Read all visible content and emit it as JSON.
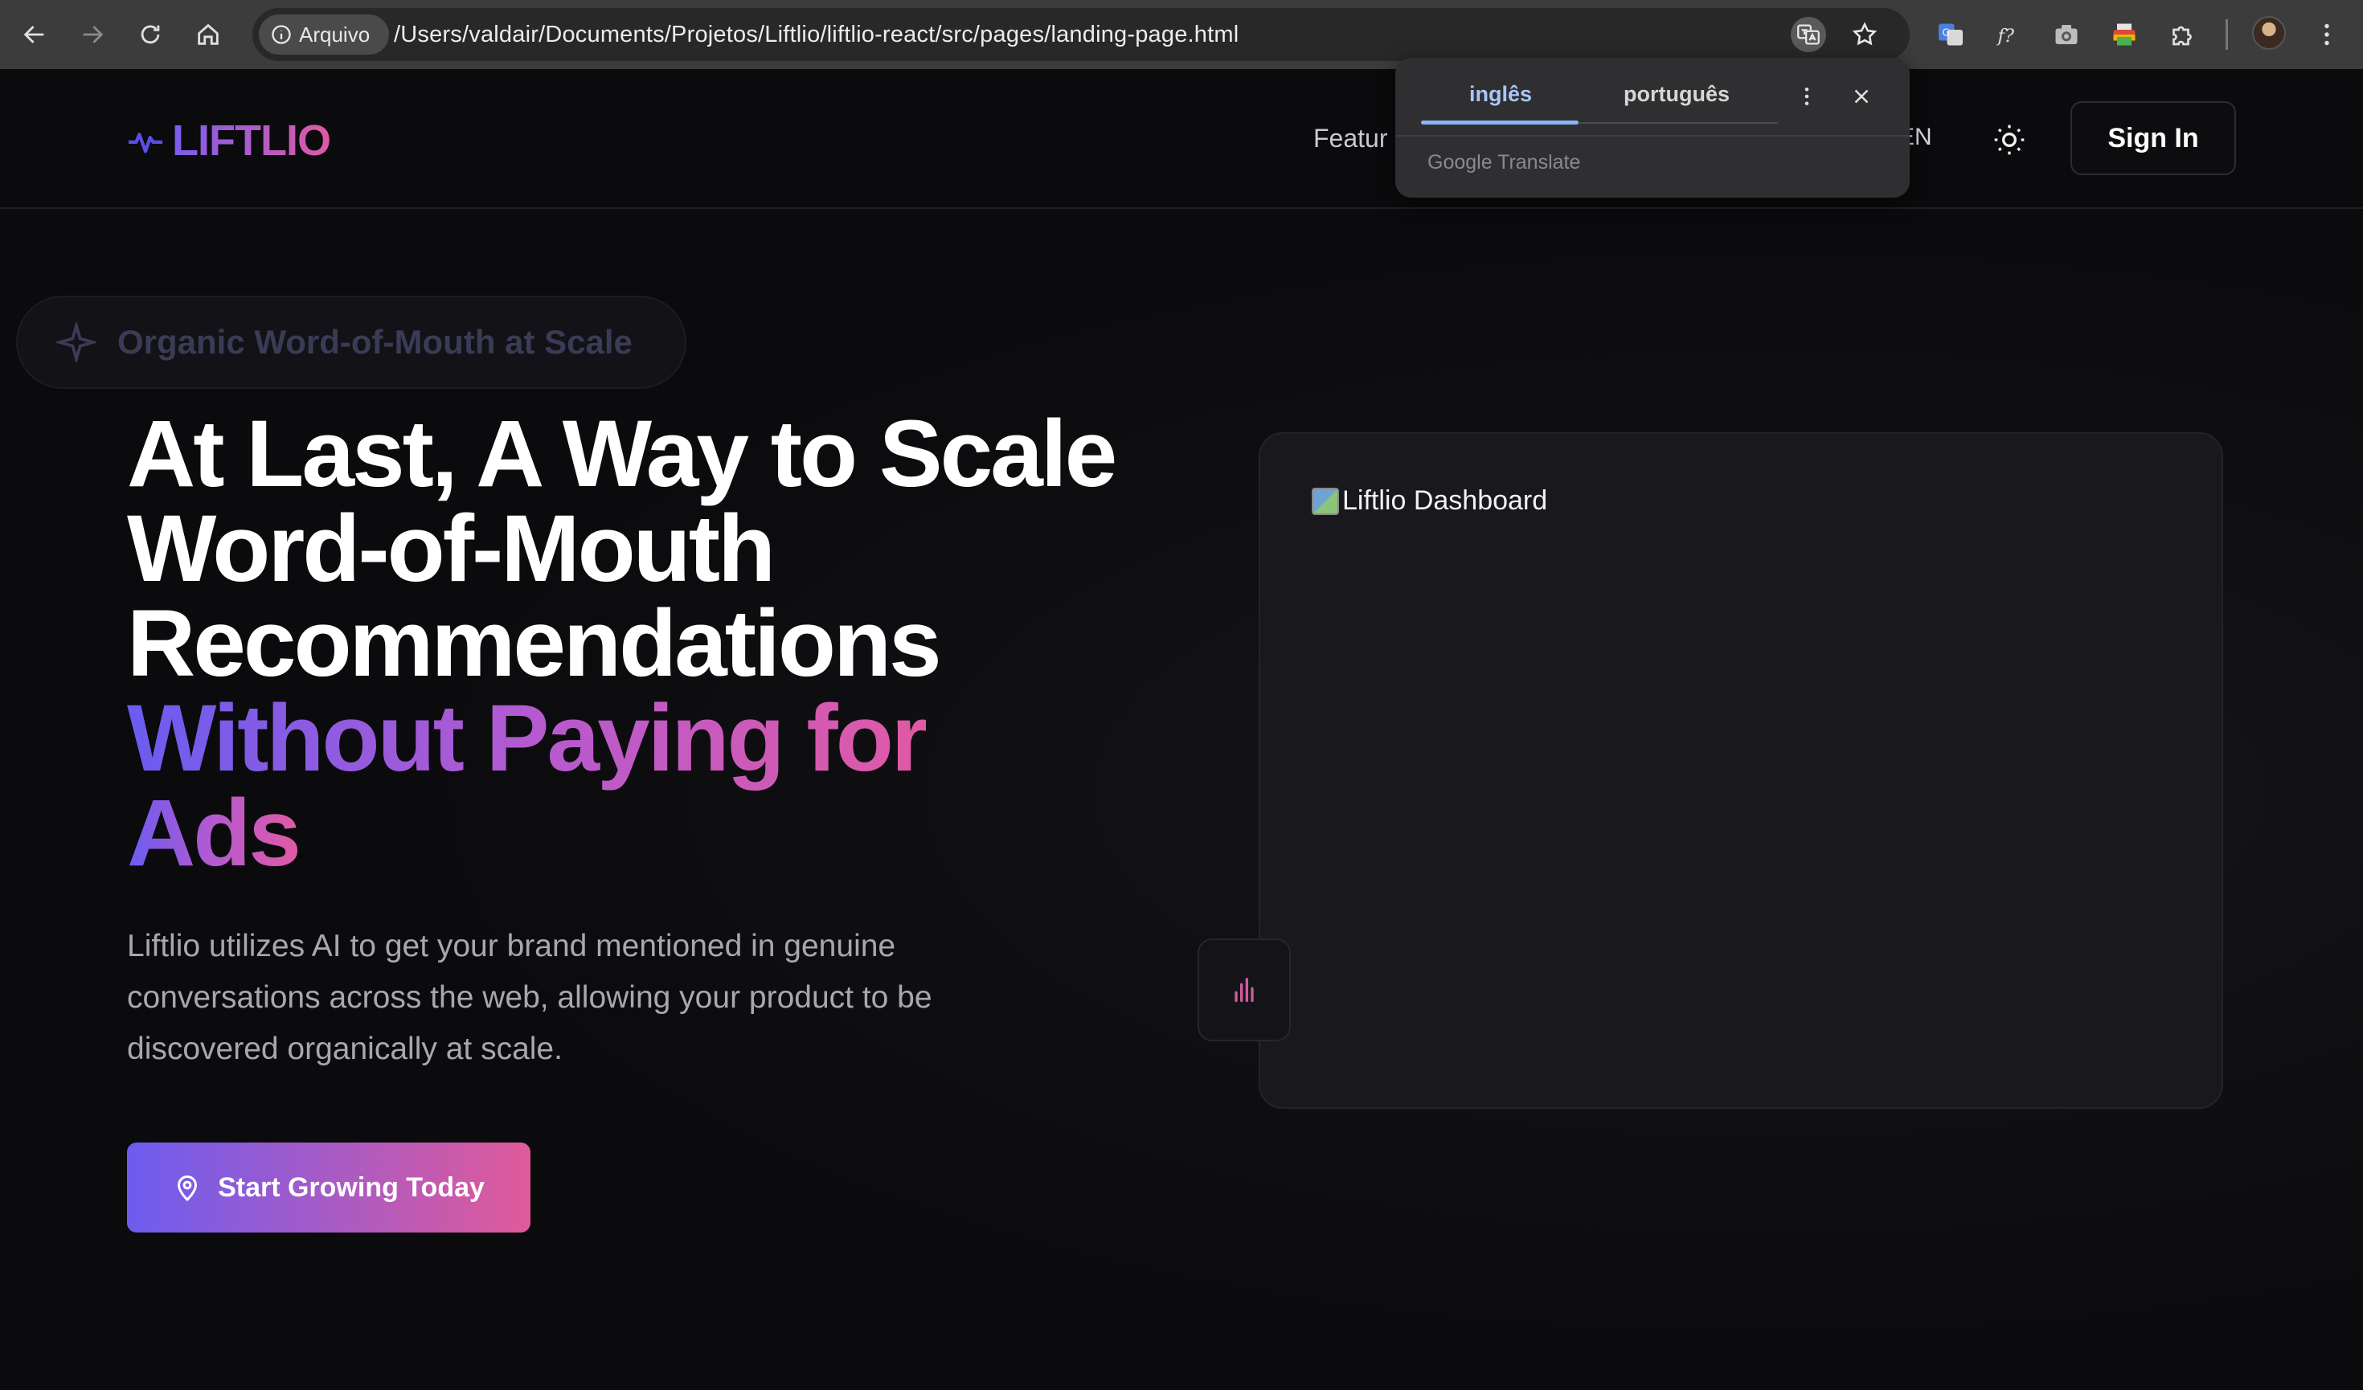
{
  "browser": {
    "site_chip_label": "Arquivo",
    "url": "/Users/valdair/Documents/Projetos/Liftlio/liftlio-react/src/pages/landing-page.html",
    "icons": [
      "back-arrow-icon",
      "forward-arrow-icon",
      "reload-icon",
      "home-icon",
      "info-icon",
      "translate-icon",
      "star-icon",
      "google-translate-extension-icon",
      "function-extension-icon",
      "camera-extension-icon",
      "printer-extension-icon",
      "extensions-puzzle-icon",
      "profile-avatar",
      "kebab-menu-icon"
    ]
  },
  "translate_popup": {
    "tab_source": "inglês",
    "tab_target": "português",
    "footer": "Google Translate",
    "accent_color": "#8ab4f8"
  },
  "header": {
    "logo_text": "LIFTLIO",
    "nav_features": "Featur",
    "language": "EN",
    "sign_in": "Sign In"
  },
  "hero": {
    "badge": "Organic Word-of-Mouth at Scale",
    "headline_line1": "At Last, A Way to Scale",
    "headline_line2": "Word-of-Mouth",
    "headline_line3": "Recommendations",
    "headline_highlight_1": "Without Paying for",
    "headline_highlight_2": "Ads",
    "subtext": "Liftlio utilizes AI to get your brand mentioned in genuine conversations across the web, allowing your product to be discovered organically at scale.",
    "cta": "Start Growing Today",
    "dashboard_alt": "Liftlio Dashboard"
  },
  "colors": {
    "brand_gradient_start": "#6d5cf0",
    "brand_gradient_end": "#e05a9a",
    "background": "#0b0b0d"
  }
}
